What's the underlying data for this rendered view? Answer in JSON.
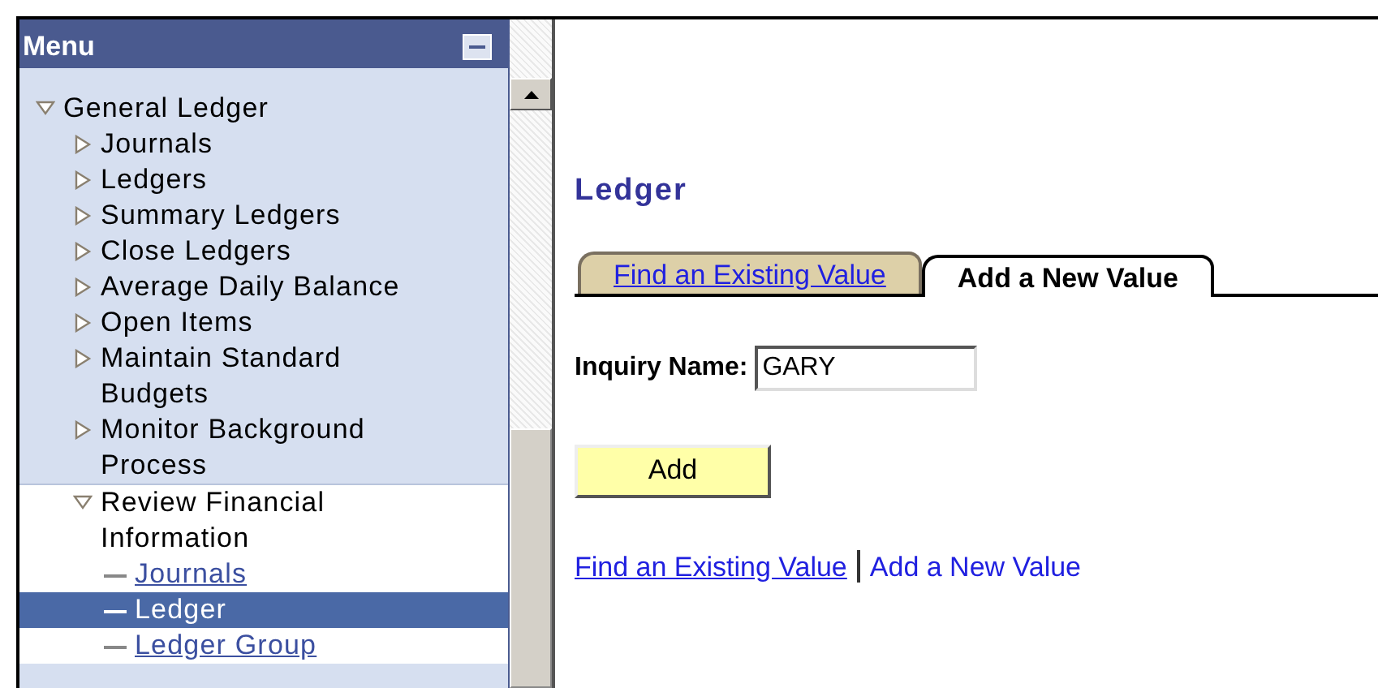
{
  "menu": {
    "title": "Menu",
    "items": [
      {
        "label": "General Ledger",
        "kind": "folder",
        "expanded": true,
        "children": [
          {
            "label": "Journals",
            "kind": "folder",
            "expanded": false
          },
          {
            "label": "Ledgers",
            "kind": "folder",
            "expanded": false
          },
          {
            "label": "Summary Ledgers",
            "kind": "folder",
            "expanded": false
          },
          {
            "label": "Close Ledgers",
            "kind": "folder",
            "expanded": false
          },
          {
            "label": "Average Daily Balance",
            "kind": "folder",
            "expanded": false
          },
          {
            "label": "Open Items",
            "kind": "folder",
            "expanded": false
          },
          {
            "label": "Maintain Standard Budgets",
            "kind": "folder",
            "expanded": false
          },
          {
            "label": "Monitor Background Process",
            "kind": "folder",
            "expanded": false
          },
          {
            "label": "Review Financial Information",
            "kind": "folder",
            "expanded": true,
            "children": [
              {
                "label": "Journals",
                "kind": "link",
                "selected": false
              },
              {
                "label": "Ledger",
                "kind": "link",
                "selected": true
              },
              {
                "label": "Ledger Group",
                "kind": "link",
                "selected": false
              }
            ]
          }
        ]
      }
    ]
  },
  "page": {
    "title": "Ledger",
    "tabs": [
      {
        "label": "Find an Existing Value",
        "selected": false
      },
      {
        "label": "Add a New Value",
        "selected": true
      }
    ],
    "field": {
      "label": "Inquiry Name:",
      "value": "GARY"
    },
    "button": "Add",
    "links": [
      {
        "label": "Find an Existing Value",
        "kind": "link"
      },
      {
        "label": "Add a New Value",
        "kind": "plain"
      }
    ]
  }
}
